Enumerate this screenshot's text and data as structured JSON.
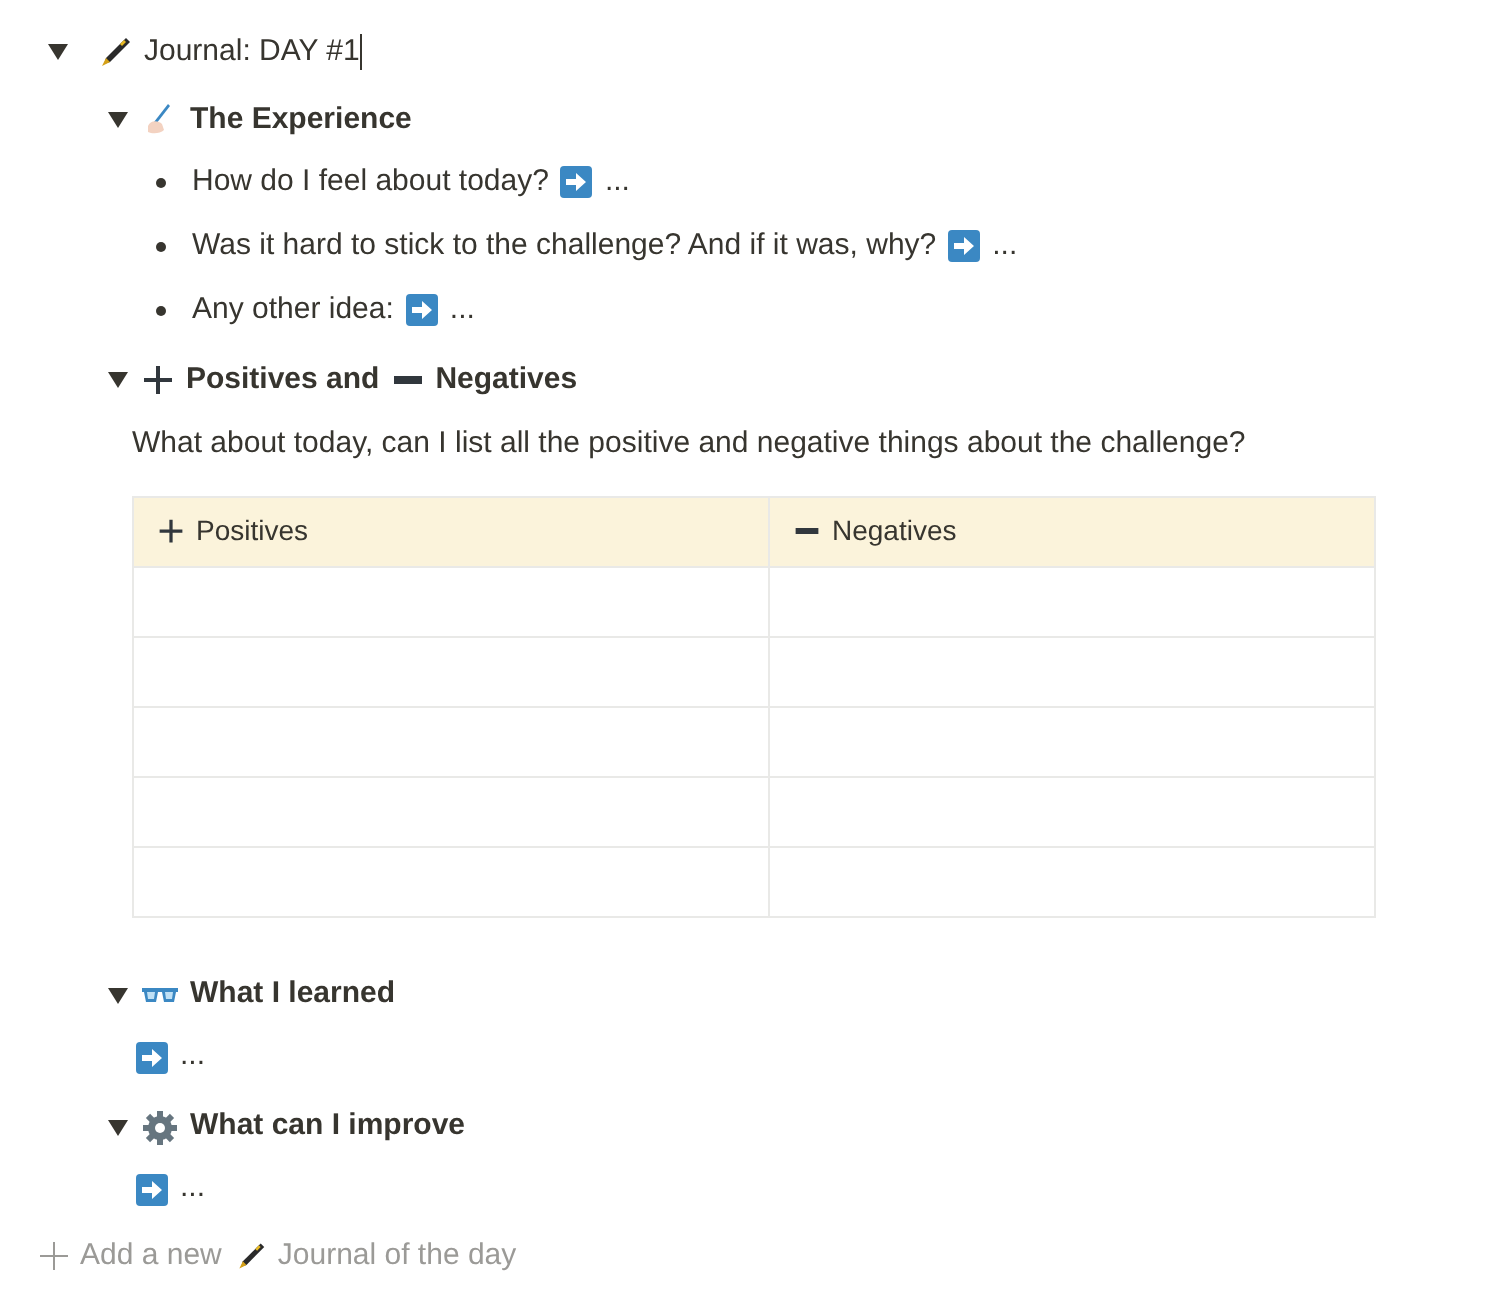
{
  "journal": {
    "title": "Journal: DAY #1",
    "expanded": true,
    "sections": [
      {
        "kind": "bullets",
        "expanded": true,
        "heading": [
          "The Experience"
        ],
        "items": [
          {
            "text": "How do I feel about today?",
            "after": "..."
          },
          {
            "text": "Was it hard to stick to the challenge? And if it was, why?",
            "after": "..."
          },
          {
            "text": "Any other idea:",
            "after": "..."
          }
        ]
      },
      {
        "kind": "table",
        "expanded": true,
        "heading": [
          "Positives and",
          "Negatives"
        ],
        "intro": "What about today, can I list all the positive and negative things about the challenge?",
        "columns": [
          "Positives",
          "Negatives"
        ]
      },
      {
        "kind": "note",
        "expanded": true,
        "heading": [
          "What I learned"
        ],
        "after": "..."
      },
      {
        "kind": "note",
        "expanded": true,
        "heading": [
          "What can I improve"
        ],
        "after": "..."
      }
    ]
  },
  "add_new": {
    "prefix": "Add a new",
    "label": "Journal of the day"
  }
}
